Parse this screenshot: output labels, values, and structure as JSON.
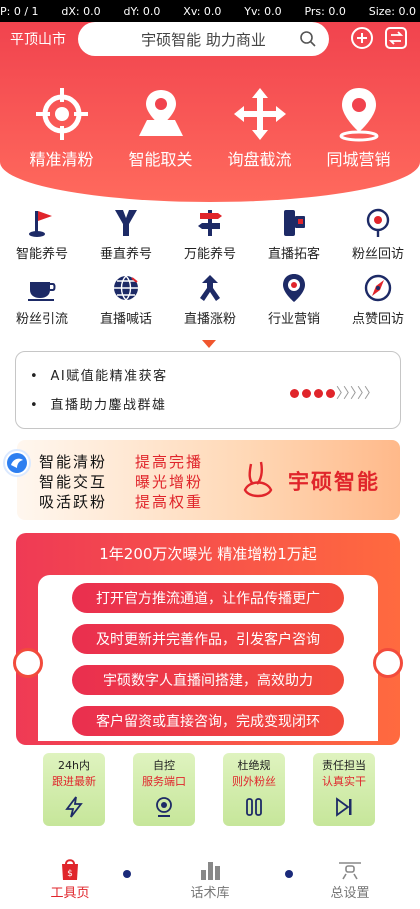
{
  "status": {
    "p": "P: 0 / 1",
    "dx": "dX: 0.0",
    "dy": "dY: 0.0",
    "xv": "Xv: 0.0",
    "yv": "Yv: 0.0",
    "prs": "Prs: 0.0",
    "size": "Size: 0.0"
  },
  "header": {
    "city": "平顶山市",
    "search_text": "宇硕智能 助力商业"
  },
  "quick_actions": [
    {
      "label": "精准清粉",
      "icon": "crosshair-icon"
    },
    {
      "label": "智能取关",
      "icon": "map-pin-icon"
    },
    {
      "label": "询盘截流",
      "icon": "move-arrows-icon"
    },
    {
      "label": "同城营销",
      "icon": "location-icon"
    }
  ],
  "features": [
    {
      "label": "智能养号",
      "icon": "flag-icon"
    },
    {
      "label": "垂直养号",
      "icon": "vertical-y-icon"
    },
    {
      "label": "万能养号",
      "icon": "signpost-icon"
    },
    {
      "label": "直播拓客",
      "icon": "phone-card-icon"
    },
    {
      "label": "粉丝回访",
      "icon": "pin-icon"
    },
    {
      "label": "粉丝引流",
      "icon": "coffee-cup-icon"
    },
    {
      "label": "直播喊话",
      "icon": "globe-icon"
    },
    {
      "label": "直播涨粉",
      "icon": "fork-arrow-icon"
    },
    {
      "label": "行业营销",
      "icon": "target-pin-icon"
    },
    {
      "label": "点赞回访",
      "icon": "compass-icon"
    }
  ],
  "notice": {
    "line1": "AI赋值能精准获客",
    "line2": "直播助力鏖战群雄"
  },
  "banner": {
    "rows": [
      {
        "left": "智能清粉",
        "right": "提高完播"
      },
      {
        "left": "智能交互",
        "right": "曝光增粉"
      },
      {
        "left": "吸活跃粉",
        "right": "提高权重"
      }
    ],
    "brand": "宇硕智能"
  },
  "promo": {
    "title": "1年200万次曝光 精准增粉1万起",
    "items": [
      "打开官方推流通道，让作品传播更广",
      "及时更新并完善作品，引发客户咨询",
      "宇硕数字人直播间搭建，高效助力",
      "客户留资或直接咨询，完成变现闭环"
    ]
  },
  "tiles": [
    {
      "t1": "24h内",
      "t2": "跟进最新",
      "icon": "lightning-icon"
    },
    {
      "t1": "自控",
      "t2": "服务端口",
      "icon": "webcam-icon"
    },
    {
      "t1": "杜绝规",
      "t2": "则外粉丝",
      "icon": "pause-icon"
    },
    {
      "t1": "责任担当",
      "t2": "认真实干",
      "icon": "skip-forward-icon"
    }
  ],
  "tabs": [
    {
      "label": "工具页",
      "icon": "shop-bag-icon"
    },
    {
      "label": "话术库",
      "icon": "bar-chart-icon"
    },
    {
      "label": "总设置",
      "icon": "drone-icon"
    }
  ],
  "colors": {
    "primary": "#f1434e",
    "accent": "#e0252b"
  }
}
